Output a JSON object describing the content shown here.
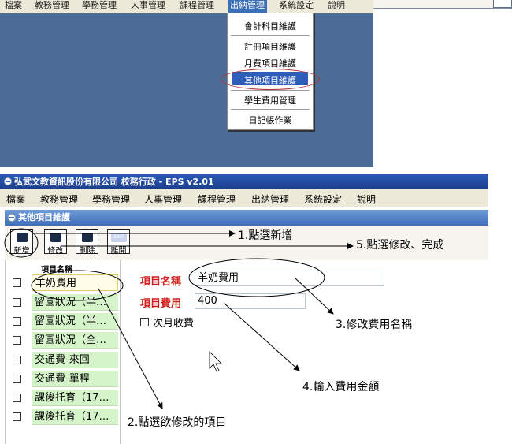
{
  "top_screenshot": {
    "menu": [
      "檔案",
      "教務管理",
      "學務管理",
      "人事管理",
      "課程管理",
      "出納管理",
      "系統設定",
      "說明"
    ],
    "active_menu": "出納管理",
    "dropdown_items": [
      "會計科目維護",
      "註冊項目維護",
      "月費項目維護",
      "其他項目維護",
      "學生費用管理",
      "日記帳作業"
    ],
    "highlighted_item": "其他項目維護"
  },
  "app": {
    "title": "弘武文教資訊股份有限公司 校務行政 - EPS v2.01",
    "menu": [
      "檔案",
      "教務管理",
      "學務管理",
      "人事管理",
      "課程管理",
      "出納管理",
      "系統設定",
      "說明"
    ],
    "window_title": "其他項目維護",
    "toolbar": [
      {
        "label": "新增",
        "icon": "new-icon"
      },
      {
        "label": "修改",
        "icon": "edit-icon"
      },
      {
        "label": "刪除",
        "icon": "delete-icon"
      },
      {
        "label": "離開",
        "icon": "exit-icon",
        "icon_text": "EXIT"
      }
    ],
    "list_header": "項目名稱",
    "list_items": [
      "羊奶費用",
      "留園狀況（半…",
      "留園狀況（半…",
      "留園狀況（全…",
      "交通費-來回",
      "交通費-單程",
      "課後托育（17…",
      "課後托育（17…"
    ],
    "selected_item": "羊奶費用",
    "form": {
      "name_label": "項目名稱",
      "name_value": "羊奶費用",
      "fee_label": "項目費用",
      "fee_value": "400",
      "monthly_label": "次月收費",
      "monthly_checked": false
    }
  },
  "annotations": {
    "step1": "1.點選新增",
    "step2": "2.點選欲修改的項目",
    "step3": "3.修改費用名稱",
    "step4": "4.輸入費用金額",
    "step5": "5.點選修改、完成"
  },
  "colors": {
    "desktop": "#4c6c98",
    "title_bar": "#2b58b8",
    "menu_highlight": "#3d6fb6",
    "field_label": "#d11b1b",
    "list_item": "#d5f4c9"
  }
}
